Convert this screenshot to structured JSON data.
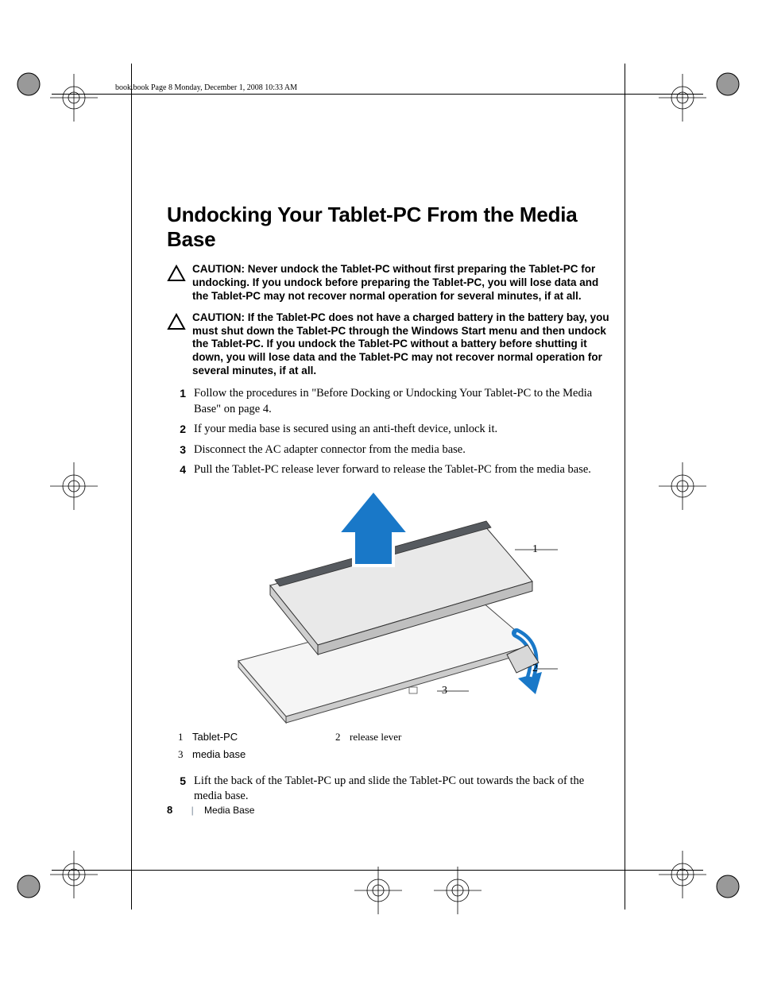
{
  "running_header": "book.book  Page 8  Monday, December 1, 2008  10:33 AM",
  "title": "Undocking Your Tablet-PC From the Media Base",
  "cautions": [
    {
      "label": "CAUTION:",
      "text": "Never undock the Tablet-PC without first preparing the Tablet-PC for undocking. If you undock before preparing the Tablet-PC, you will lose data and the Tablet-PC may not recover normal operation for several minutes, if at all."
    },
    {
      "label": "CAUTION:",
      "text_before_bold": "If the Tablet-PC does not have a charged battery in the battery bay, you must shut down the Tablet-PC through the Windows ",
      "bold_word": "Start",
      "text_after_bold": " menu and then undock the Tablet-PC. If you undock the Tablet-PC without a battery before shutting it down, you will lose data and the Tablet-PC may not recover normal operation for several minutes, if at all."
    }
  ],
  "steps": [
    {
      "n": "1",
      "text": "Follow the procedures in \"Before Docking or Undocking Your Tablet-PC to the Media Base\" on page 4."
    },
    {
      "n": "2",
      "text": "If your media base is secured using an anti-theft device, unlock it."
    },
    {
      "n": "3",
      "text": "Disconnect the AC adapter connector from the media base."
    },
    {
      "n": "4",
      "text": "Pull the Tablet-PC release lever forward to release the Tablet-PC from the media base."
    },
    {
      "n": "5",
      "text": "Lift the back of the Tablet-PC up and slide the Tablet-PC out towards the back of the media base."
    }
  ],
  "figure": {
    "callouts": {
      "c1": "1",
      "c2": "2",
      "c3": "3"
    },
    "legend": [
      {
        "n": "1",
        "label": "Tablet-PC",
        "style": "sans"
      },
      {
        "n": "2",
        "label": "release lever",
        "style": "serif"
      },
      {
        "n": "3",
        "label": "media base",
        "style": "sans"
      }
    ]
  },
  "footer": {
    "page_number": "8",
    "section": "Media Base"
  }
}
